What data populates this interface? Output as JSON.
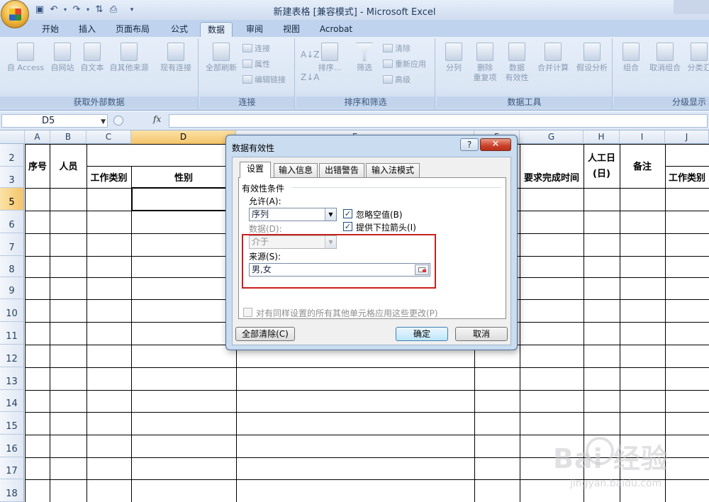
{
  "window": {
    "title": "新建表格  [兼容模式] - Microsoft Excel"
  },
  "ribbon": {
    "tabs": [
      {
        "label": "开始",
        "active": false
      },
      {
        "label": "插入",
        "active": false
      },
      {
        "label": "页面布局",
        "active": false
      },
      {
        "label": "公式",
        "active": false
      },
      {
        "label": "数据",
        "active": true
      },
      {
        "label": "审阅",
        "active": false
      },
      {
        "label": "视图",
        "active": false
      },
      {
        "label": "Acrobat",
        "active": false
      }
    ],
    "groups": {
      "external": {
        "label": "获取外部数据",
        "buttons": [
          "自 Access",
          "自网站",
          "自文本",
          "自其他来源",
          "现有连接"
        ]
      },
      "connections": {
        "label": "连接",
        "refresh": "全部刷新",
        "small": [
          "连接",
          "属性",
          "编辑链接"
        ]
      },
      "sort": {
        "label": "排序和筛选",
        "sort": "排序...",
        "filter": "筛选",
        "small": [
          "清除",
          "重新应用",
          "高级"
        ]
      },
      "tools": {
        "label": "数据工具",
        "split": "分列",
        "remove_dup_1": "删除",
        "remove_dup_2": "重复项",
        "validation_1": "数据",
        "validation_2": "有效性",
        "consolidate": "合并计算",
        "whatif": "假设分析"
      },
      "outline": {
        "label": "分级显示",
        "group": "组合",
        "ungroup": "取消组合",
        "subtotal": "分类汇"
      }
    }
  },
  "formula_bar": {
    "name_box": "D5",
    "fx": "fx",
    "formula": ""
  },
  "grid": {
    "columns": [
      "A",
      "B",
      "C",
      "D",
      "E",
      "F",
      "G",
      "H",
      "I",
      "J"
    ],
    "rows": [
      "2",
      "3",
      "5",
      "6",
      "7",
      "8",
      "9",
      "10",
      "11",
      "12",
      "13",
      "14",
      "15",
      "16",
      "17",
      "18"
    ],
    "selected_column": "D",
    "selected_row": "5",
    "headers": {
      "seq": "序号",
      "person": "人员",
      "work_type": "工作类别",
      "gender": "性别",
      "deadline": "要求完成时间",
      "man_days_1": "人工日",
      "man_days_2": "(日)",
      "remarks": "备注",
      "work_type_2": "工作类别"
    }
  },
  "dialog": {
    "title": "数据有效性",
    "help": "?",
    "close": "✕",
    "tabs": [
      {
        "label": "设置",
        "active": true
      },
      {
        "label": "输入信息",
        "active": false
      },
      {
        "label": "出错警告",
        "active": false
      },
      {
        "label": "输入法模式",
        "active": false
      }
    ],
    "section_title": "有效性条件",
    "allow_label": "允许(A):",
    "allow_value": "序列",
    "ignore_blank": {
      "label": "忽略空值(B)",
      "checked": true
    },
    "dropdown_arrow": {
      "label": "提供下拉箭头(I)",
      "checked": true
    },
    "data_label": "数据(D):",
    "data_value": "介于",
    "source_label": "来源(S):",
    "source_value": "男,女",
    "apply_all": {
      "label": "对有同样设置的所有其他单元格应用这些更改(P)",
      "checked": false
    },
    "clear_all": "全部清除(C)",
    "ok": "确定",
    "cancel": "取消"
  },
  "watermark": {
    "text": "Bai  经验",
    "url": "jingyan.baidu.com"
  },
  "colors": {
    "ribbon_bg": "#dbe6f4",
    "highlight_box": "#c8201e",
    "selected_header": "#f4c46a",
    "close_button": "#c9412a"
  }
}
